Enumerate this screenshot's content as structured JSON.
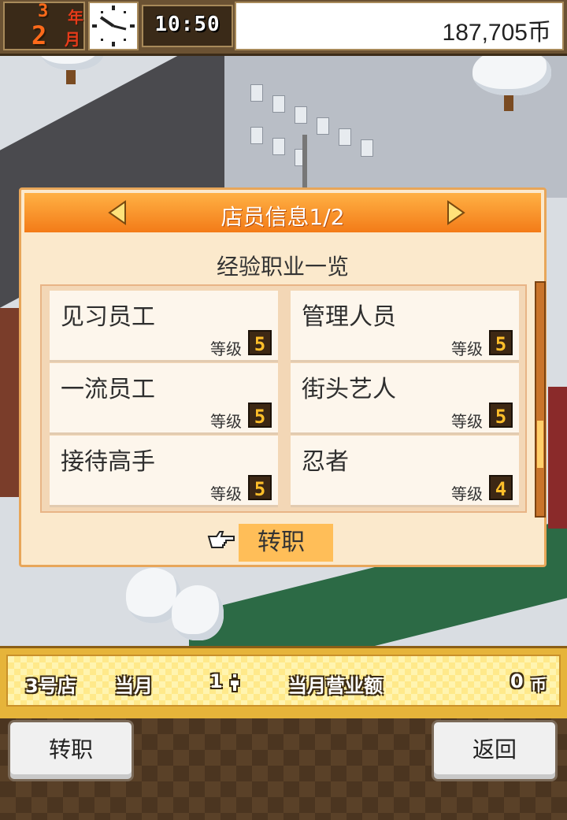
{
  "top_bar": {
    "year_number": "3",
    "year_unit": "年",
    "month_number": "2",
    "month_unit": "月",
    "time": "10:50",
    "money": "187,705币"
  },
  "panel": {
    "title": "店员信息1/2",
    "subtitle": "经验职业一览",
    "level_label": "等级",
    "jobs": [
      {
        "name": "见习员工",
        "level": "5"
      },
      {
        "name": "管理人员",
        "level": "5"
      },
      {
        "name": "一流员工",
        "level": "5"
      },
      {
        "name": "街头艺人",
        "level": "5"
      },
      {
        "name": "接待高手",
        "level": "5"
      },
      {
        "name": "忍者",
        "level": "4"
      }
    ],
    "transfer_label": "转职"
  },
  "store_bar": {
    "store": "3号店",
    "month_label": "当月",
    "visitors": "1",
    "person_icon": "person-icon",
    "sales_label": "当月营业额",
    "sales_value": "0",
    "currency": "币"
  },
  "bottom_bar": {
    "left_button": "转职",
    "right_button": "返回"
  },
  "colors": {
    "header_orange": "#f37b18",
    "panel_bg": "#fbe9cc",
    "badge_gold": "#ffbf2a"
  }
}
